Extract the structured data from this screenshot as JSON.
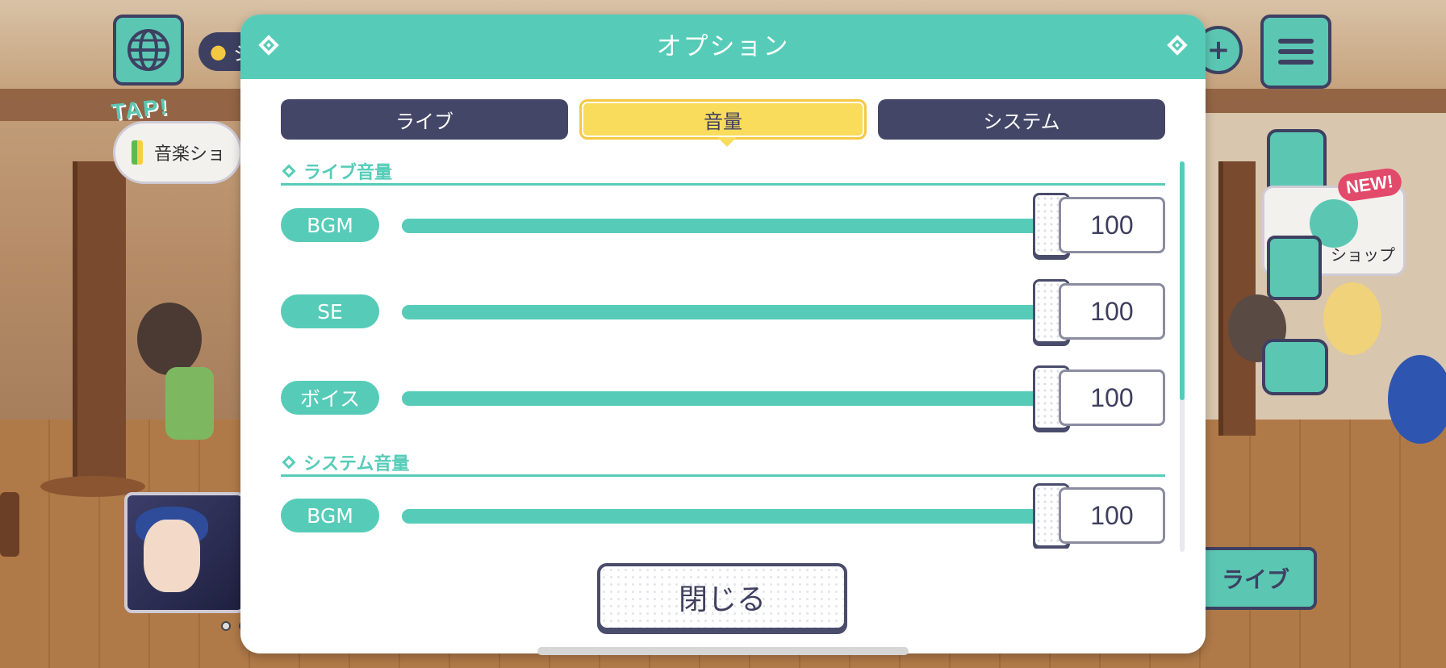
{
  "dialog": {
    "title": "オプション"
  },
  "tabs": [
    {
      "label": "ライブ",
      "active": false
    },
    {
      "label": "音量",
      "active": true
    },
    {
      "label": "システム",
      "active": false
    }
  ],
  "sections": [
    {
      "title": "ライブ音量",
      "rows": [
        {
          "label": "BGM",
          "value": "100",
          "level": 1.0
        },
        {
          "label": "SE",
          "value": "100",
          "level": 1.0
        },
        {
          "label": "ボイス",
          "value": "100",
          "level": 1.0
        }
      ]
    },
    {
      "title": "システム音量",
      "rows": [
        {
          "label": "BGM",
          "value": "100",
          "level": 1.0
        }
      ]
    }
  ],
  "close_button": {
    "label": "閉じる"
  },
  "background": {
    "tap_label": "TAP!",
    "music_shop_label": "音楽ショ",
    "location_label": "シ",
    "new_badge": "NEW!",
    "shop_label": "ショップ",
    "live_button_label": "ライブ"
  },
  "colors": {
    "accent": "#56ccb8",
    "tab_inactive": "#444668",
    "tab_active": "#f9dc5c",
    "text_dark": "#3e3f5e"
  }
}
